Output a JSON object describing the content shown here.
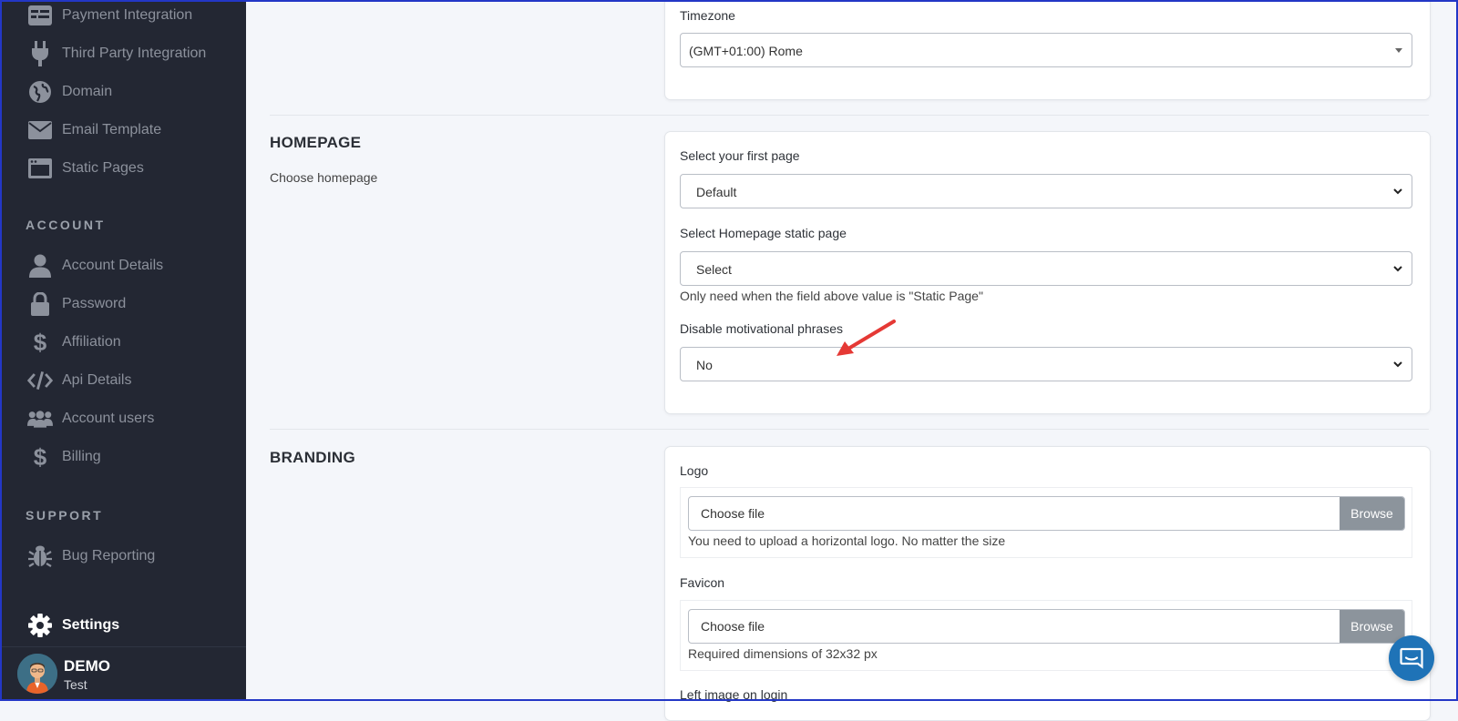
{
  "sidebar": {
    "items_top": [
      {
        "label": "Payment Integration",
        "icon": "payment-icon"
      },
      {
        "label": "Third Party Integration",
        "icon": "plug-icon"
      },
      {
        "label": "Domain",
        "icon": "globe-icon"
      },
      {
        "label": "Email Template",
        "icon": "envelope-icon"
      },
      {
        "label": "Static Pages",
        "icon": "window-icon"
      }
    ],
    "account_heading": "ACCOUNT",
    "account_items": [
      {
        "label": "Account Details",
        "icon": "user-icon"
      },
      {
        "label": "Password",
        "icon": "lock-icon"
      },
      {
        "label": "Affiliation",
        "icon": "dollar-icon"
      },
      {
        "label": "Api Details",
        "icon": "code-icon"
      },
      {
        "label": "Account users",
        "icon": "users-icon"
      },
      {
        "label": "Billing",
        "icon": "dollar-icon"
      }
    ],
    "support_heading": "SUPPORT",
    "support_items": [
      {
        "label": "Bug Reporting",
        "icon": "bug-icon"
      }
    ],
    "settings_label": "Settings",
    "user": {
      "name": "DEMO",
      "subtitle": "Test"
    }
  },
  "general": {
    "timezone_label": "Timezone",
    "timezone_value": "(GMT+01:00) Rome"
  },
  "homepage": {
    "title": "HOMEPAGE",
    "description": "Choose homepage",
    "first_page_label": "Select your first page",
    "first_page_value": "Default",
    "static_page_label": "Select Homepage static page",
    "static_page_value": "Select",
    "static_page_help": "Only need when the field above value is \"Static Page\"",
    "motivational_label": "Disable motivational phrases",
    "motivational_value": "No"
  },
  "branding": {
    "title": "BRANDING",
    "logo_label": "Logo",
    "logo_placeholder": "Choose file",
    "logo_button": "Browse",
    "logo_help": "You need to upload a horizontal logo. No matter the size",
    "favicon_label": "Favicon",
    "favicon_placeholder": "Choose file",
    "favicon_button": "Browse",
    "favicon_help": "Required dimensions of 32x32 px",
    "left_image_label": "Left image on login"
  },
  "colors": {
    "sidebar_bg": "#232733",
    "accent": "#1f73b7",
    "arrow": "#e53935"
  }
}
